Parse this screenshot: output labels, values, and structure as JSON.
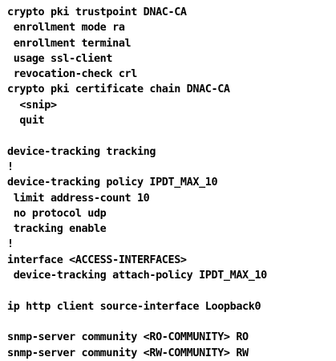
{
  "config": {
    "lines": [
      "crypto pki trustpoint DNAC-CA",
      " enrollment mode ra",
      " enrollment terminal",
      " usage ssl-client",
      " revocation-check crl",
      "crypto pki certificate chain DNAC-CA",
      "  <snip>",
      "  quit",
      "",
      "device-tracking tracking",
      "!",
      "device-tracking policy IPDT_MAX_10",
      " limit address-count 10",
      " no protocol udp",
      " tracking enable",
      "!",
      "interface <ACCESS-INTERFACES>",
      " device-tracking attach-policy IPDT_MAX_10",
      "",
      "ip http client source-interface Loopback0",
      "",
      "snmp-server community <RO-COMMUNITY> RO",
      "snmp-server community <RW-COMMUNITY> RW"
    ]
  }
}
